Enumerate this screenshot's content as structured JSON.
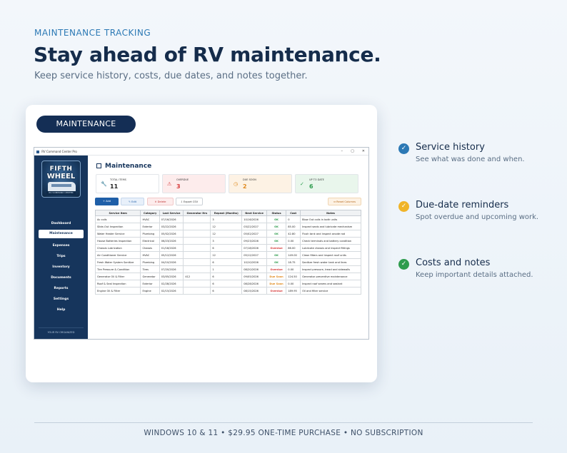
{
  "hero": {
    "eyebrow": "MAINTENANCE TRACKING",
    "headline": "Stay ahead of RV maintenance.",
    "subhead": "Keep service history, costs, due dates, and notes together."
  },
  "card": {
    "pill_label": "MAINTENANCE"
  },
  "window": {
    "title": "RV Command Center Pro",
    "controls": {
      "minimize": "–",
      "maximize": "▢",
      "close": "✕"
    }
  },
  "logo": {
    "line1": "FIFTH",
    "line2": "WHEEL",
    "tagline": "RV COMMAND CENTER"
  },
  "sidebar": {
    "items": [
      {
        "label": "Dashboard",
        "active": false
      },
      {
        "label": "Maintenance",
        "active": true
      },
      {
        "label": "Expenses",
        "active": false
      },
      {
        "label": "Trips",
        "active": false
      },
      {
        "label": "Inventory",
        "active": false
      },
      {
        "label": "Documents",
        "active": false
      },
      {
        "label": "Reports",
        "active": false
      },
      {
        "label": "Settings",
        "active": false
      },
      {
        "label": "Help",
        "active": false
      }
    ],
    "footer": "YOUR RV ORGANIZED"
  },
  "page": {
    "title": "Maintenance",
    "icon": "clipboard-icon"
  },
  "stats": [
    {
      "label": "TOTAL ITEMS",
      "value": "11",
      "icon": "wrench-icon",
      "color": "#222222"
    },
    {
      "label": "OVERDUE",
      "value": "3",
      "icon": "warning-icon",
      "color": "#d63a3a"
    },
    {
      "label": "DUE SOON",
      "value": "2",
      "icon": "clock-icon",
      "color": "#e08a1e"
    },
    {
      "label": "UP TO DATE",
      "value": "6",
      "icon": "check-icon",
      "color": "#2e9c4e"
    }
  ],
  "toolbar": {
    "add": "+ Add",
    "edit": "✎ Edit",
    "delete": "✕ Delete",
    "export": "⇩ Export CSV",
    "reset": "⇔ Reset Columns"
  },
  "table": {
    "columns": [
      "Service Item",
      "Category",
      "Last Service",
      "Generator Hrs",
      "Repeat (Months)",
      "Next Service",
      "Status",
      "Cost",
      "Notes"
    ],
    "rows": [
      [
        "Ac coils",
        "HVAC",
        "07/16/2026",
        "",
        "3",
        "10/16/2026",
        "OK",
        "0",
        "Blow Out coils in both units"
      ],
      [
        "Slide-Out Inspection",
        "Exterior",
        "03/22/2026",
        "",
        "12",
        "03/22/2027",
        "OK",
        "85.00",
        "Inspect seals and lubricate mechanism"
      ],
      [
        "Water Heater Service",
        "Plumbing",
        "05/02/2026",
        "",
        "12",
        "05/02/2027",
        "OK",
        "42.80",
        "Flush tank and inspect anode rod"
      ],
      [
        "House Batteries Inspection",
        "Electrical",
        "06/23/2026",
        "",
        "3",
        "09/23/2026",
        "OK",
        "0.00",
        "Check terminals and battery condition"
      ],
      [
        "Chassis Lubrication",
        "Chassis",
        "01/18/2026",
        "",
        "6",
        "07/18/2026",
        "Overdue",
        "86.00",
        "Lubricate chassis and inspect fittings"
      ],
      [
        "Air Conditioner Service",
        "HVAC",
        "05/12/2026",
        "",
        "12",
        "05/12/2027",
        "OK",
        "149.00",
        "Clean filters and inspect roof units"
      ],
      [
        "Fresh Water System Sanitize",
        "Plumbing",
        "04/10/2026",
        "",
        "6",
        "10/10/2026",
        "OK",
        "18.75",
        "Sanitize fresh water tank and lines"
      ],
      [
        "Tire Pressure & Condition",
        "Tires",
        "07/20/2026",
        "",
        "1",
        "08/20/2026",
        "Overdue",
        "0.00",
        "Inspect pressure, tread and sidewalls"
      ],
      [
        "Generator Oil & Filter",
        "Generator",
        "03/05/2026",
        "412",
        "6",
        "09/05/2026",
        "Due Soon",
        "124.50",
        "Generator preventive maintenance"
      ],
      [
        "Roof & Seal Inspection",
        "Exterior",
        "02/28/2026",
        "",
        "6",
        "08/28/2026",
        "Due Soon",
        "0.00",
        "Inspect roof seams and sealant"
      ],
      [
        "Engine Oil & Filter",
        "Engine",
        "02/15/2026",
        "",
        "6",
        "08/15/2026",
        "Overdue",
        "189.95",
        "Oil and filter service"
      ]
    ],
    "status_colors": {
      "OK": "#2e9c4e",
      "Overdue": "#d63a3a",
      "Due Soon": "#e08a1e"
    }
  },
  "features": [
    {
      "title": "Service history",
      "desc": "See what was done and when.",
      "color": "#2c79b5"
    },
    {
      "title": "Due-date reminders",
      "desc": "Spot overdue and upcoming work.",
      "color": "#f0b429"
    },
    {
      "title": "Costs and notes",
      "desc": "Keep important details attached.",
      "color": "#2e9c4e"
    }
  ],
  "footer": "WINDOWS 10 & 11  •  $29.95 ONE-TIME PURCHASE  •  NO SUBSCRIPTION"
}
